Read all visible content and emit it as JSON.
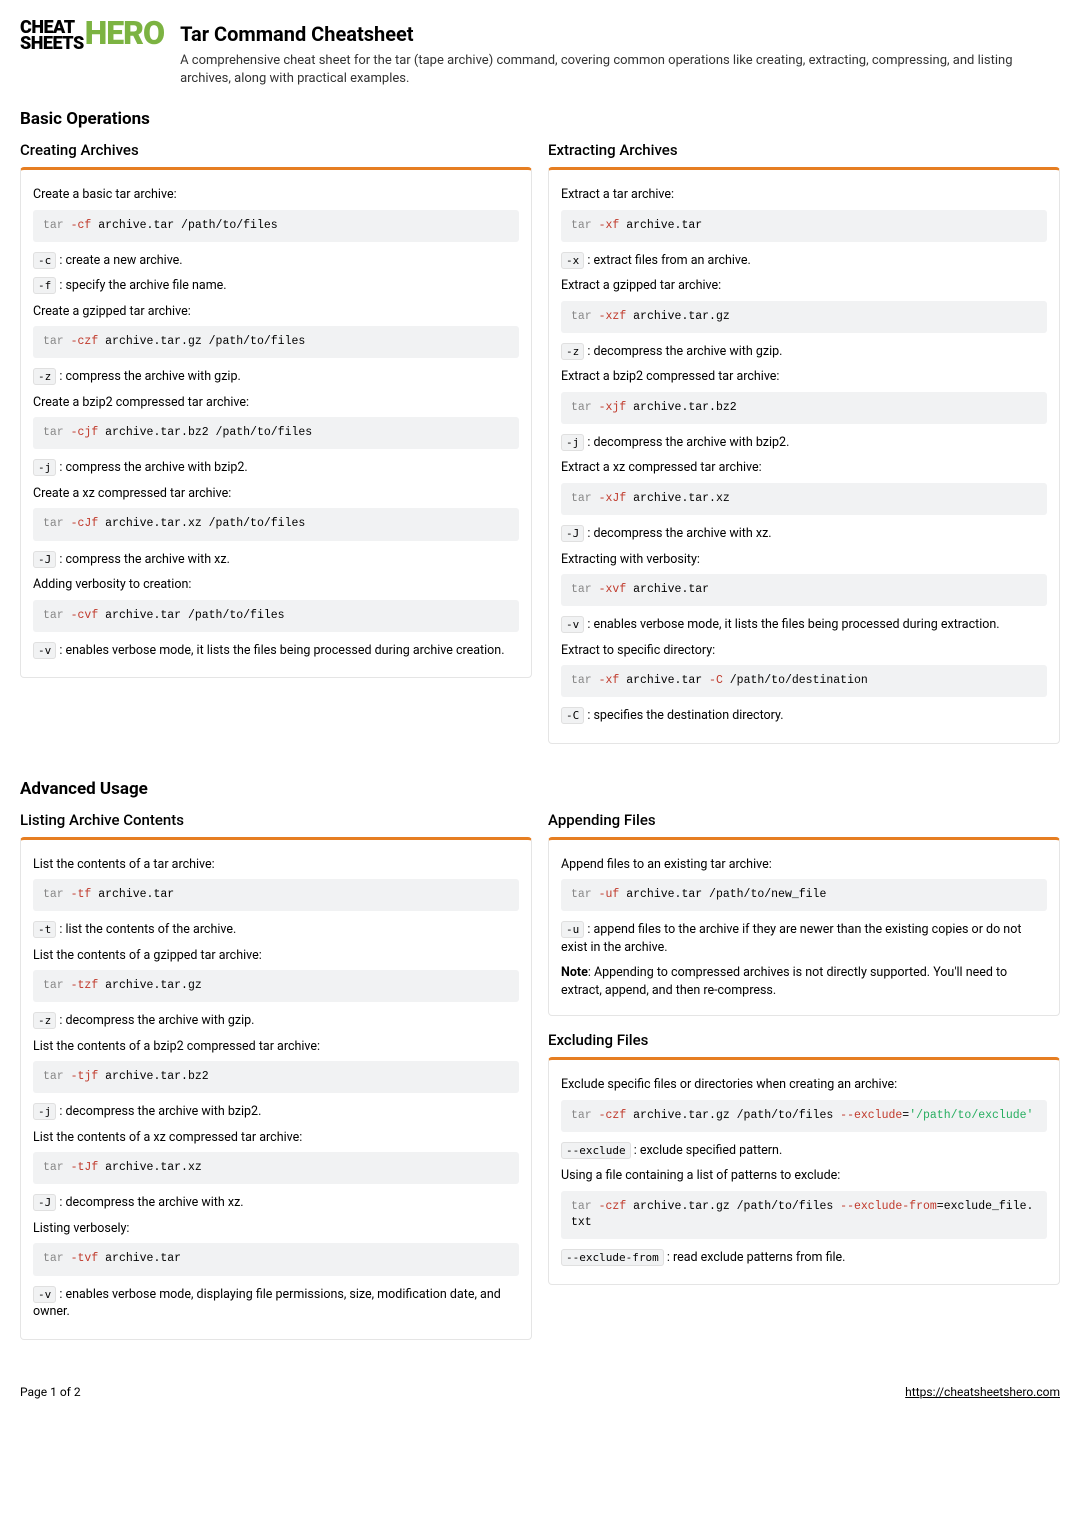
{
  "logo": {
    "left1": "CHEAT",
    "left2": "SHEETS",
    "right": "HERO"
  },
  "title": "Tar Command Cheatsheet",
  "description": "A comprehensive cheat sheet for the tar (tape archive) command, covering common operations like creating, extracting, compressing, and listing archives, along with practical examples.",
  "sections": {
    "basic": "Basic Operations",
    "advanced": "Advanced Usage"
  },
  "creating": {
    "title": "Creating Archives",
    "t1": "Create a basic tar archive:",
    "c1_a": "tar",
    "c1_b": " -cf",
    "c1_c": " archive.tar /path/to/files",
    "o1a_k": "-c",
    "o1a_v": " : create a new archive.",
    "o1b_k": "-f",
    "o1b_v": " : specify the archive file name.",
    "t2": "Create a gzipped tar archive:",
    "c2_a": "tar",
    "c2_b": " -czf",
    "c2_c": " archive.tar.gz /path/to/files",
    "o2_k": "-z",
    "o2_v": " : compress the archive with gzip.",
    "t3": "Create a bzip2 compressed tar archive:",
    "c3_a": "tar",
    "c3_b": " -cjf",
    "c3_c": " archive.tar.bz2 /path/to/files",
    "o3_k": "-j",
    "o3_v": " : compress the archive with bzip2.",
    "t4": "Create a xz compressed tar archive:",
    "c4_a": "tar",
    "c4_b": " -cJf",
    "c4_c": " archive.tar.xz /path/to/files",
    "o4_k": "-J",
    "o4_v": " : compress the archive with xz.",
    "t5": "Adding verbosity to creation:",
    "c5_a": "tar",
    "c5_b": " -cvf",
    "c5_c": " archive.tar /path/to/files",
    "o5_k": "-v",
    "o5_v": " : enables verbose mode, it lists the files being processed during archive creation."
  },
  "extracting": {
    "title": "Extracting Archives",
    "t1": "Extract a tar archive:",
    "c1_a": "tar",
    "c1_b": " -xf",
    "c1_c": " archive.tar",
    "o1_k": "-x",
    "o1_v": " : extract files from an archive.",
    "t2": "Extract a gzipped tar archive:",
    "c2_a": "tar",
    "c2_b": " -xzf",
    "c2_c": " archive.tar.gz",
    "o2_k": "-z",
    "o2_v": " : decompress the archive with gzip.",
    "t3": "Extract a bzip2 compressed tar archive:",
    "c3_a": "tar",
    "c3_b": " -xjf",
    "c3_c": " archive.tar.bz2",
    "o3_k": "-j",
    "o3_v": " : decompress the archive with bzip2.",
    "t4": "Extract a xz compressed tar archive:",
    "c4_a": "tar",
    "c4_b": " -xJf",
    "c4_c": " archive.tar.xz",
    "o4_k": "-J",
    "o4_v": " : decompress the archive with xz.",
    "t5": "Extracting with verbosity:",
    "c5_a": "tar",
    "c5_b": " -xvf",
    "c5_c": " archive.tar",
    "o5_k": "-v",
    "o5_v": " : enables verbose mode, it lists the files being processed during extraction.",
    "t6": "Extract to specific directory:",
    "c6_a": "tar",
    "c6_b": " -xf",
    "c6_c": " archive.tar ",
    "c6_d": "-C",
    "c6_e": " /path/to/destination",
    "o6_k": "-C",
    "o6_v": " : specifies the destination directory."
  },
  "listing": {
    "title": "Listing Archive Contents",
    "t1": "List the contents of a tar archive:",
    "c1_a": "tar",
    "c1_b": " -tf",
    "c1_c": " archive.tar",
    "o1_k": "-t",
    "o1_v": " : list the contents of the archive.",
    "t2": "List the contents of a gzipped tar archive:",
    "c2_a": "tar",
    "c2_b": " -tzf",
    "c2_c": " archive.tar.gz",
    "o2_k": "-z",
    "o2_v": " : decompress the archive with gzip.",
    "t3": "List the contents of a bzip2 compressed tar archive:",
    "c3_a": "tar",
    "c3_b": " -tjf",
    "c3_c": " archive.tar.bz2",
    "o3_k": "-j",
    "o3_v": " : decompress the archive with bzip2.",
    "t4": "List the contents of a xz compressed tar archive:",
    "c4_a": "tar",
    "c4_b": " -tJf",
    "c4_c": " archive.tar.xz",
    "o4_k": "-J",
    "o4_v": " : decompress the archive with xz.",
    "t5": "Listing verbosely:",
    "c5_a": "tar",
    "c5_b": " -tvf",
    "c5_c": " archive.tar",
    "o5_k": "-v",
    "o5_v": " : enables verbose mode, displaying file permissions, size, modification date, and owner."
  },
  "appending": {
    "title": "Appending Files",
    "t1": "Append files to an existing tar archive:",
    "c1_a": "tar",
    "c1_b": " -uf",
    "c1_c": " archive.tar /path/to/new_file",
    "o1_k": "-u",
    "o1_v": " : append files to the archive if they are newer than the existing copies or do not exist in the archive.",
    "note_label": "Note",
    "note_text": ": Appending to compressed archives is not directly supported. You'll need to extract, append, and then re-compress."
  },
  "excluding": {
    "title": "Excluding Files",
    "t1": "Exclude specific files or directories when creating an archive:",
    "c1_a": "tar",
    "c1_b": " -czf",
    "c1_c": " archive.tar.gz /path/to/files ",
    "c1_d": "--exclude",
    "c1_e": "=",
    "c1_f": "'/path/to/exclude'",
    "o1_k": "--exclude",
    "o1_v": " : exclude specified pattern.",
    "t2": "Using a file containing a list of patterns to exclude:",
    "c2_a": "tar",
    "c2_b": " -czf",
    "c2_c": " archive.tar.gz /path/to/files ",
    "c2_d": "--exclude-from",
    "c2_e": "=exclude_file.txt",
    "o2_k": "--exclude-from",
    "o2_v": " : read exclude patterns from file."
  },
  "footer": {
    "page": "Page 1 of 2",
    "url": "https://cheatsheetshero.com"
  }
}
